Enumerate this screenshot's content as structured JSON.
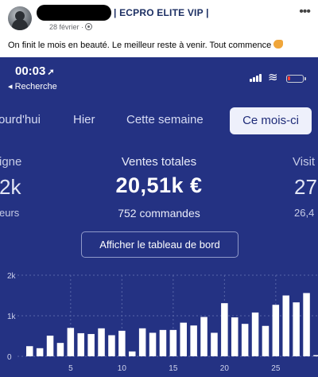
{
  "post": {
    "group_name": "| ECPRO ELITE VIP |",
    "date": "28 février ·",
    "text": "On finit le mois en beauté. Le meilleur reste à venir. Tout commence"
  },
  "status_bar": {
    "time": "00:03",
    "back_label": "◂ Recherche"
  },
  "tabs": {
    "aujourdhui": "ourd'hui",
    "hier": "Hier",
    "semaine": "Cette semaine",
    "mois": "Ce mois-ci"
  },
  "kpi": {
    "left_label": "igne",
    "left_value": "2k",
    "left_sub": "eurs",
    "label": "Ventes totales",
    "value": "20,51k €",
    "orders": "752 commandes",
    "right_label": "Visit",
    "right_value": "27",
    "right_sub": "26,4",
    "dashboard_button": "Afficher le tableau de bord"
  },
  "chart_data": {
    "type": "bar",
    "y_ticks": [
      "0",
      "1k",
      "2k"
    ],
    "ylim": [
      0,
      2000
    ],
    "x_ticks": [
      "5",
      "10",
      "15",
      "20",
      "25"
    ],
    "categories": [
      1,
      2,
      3,
      4,
      5,
      6,
      7,
      8,
      9,
      10,
      11,
      12,
      13,
      14,
      15,
      16,
      17,
      18,
      19,
      20,
      21,
      22,
      23,
      24,
      25,
      26,
      27,
      28
    ],
    "values": [
      250,
      200,
      510,
      330,
      700,
      570,
      550,
      690,
      520,
      630,
      120,
      690,
      580,
      650,
      650,
      830,
      760,
      970,
      580,
      1310,
      960,
      800,
      1080,
      750,
      1270,
      1500,
      1330,
      1560
    ],
    "grid": "dashed",
    "bar_color": "#ffffff"
  }
}
